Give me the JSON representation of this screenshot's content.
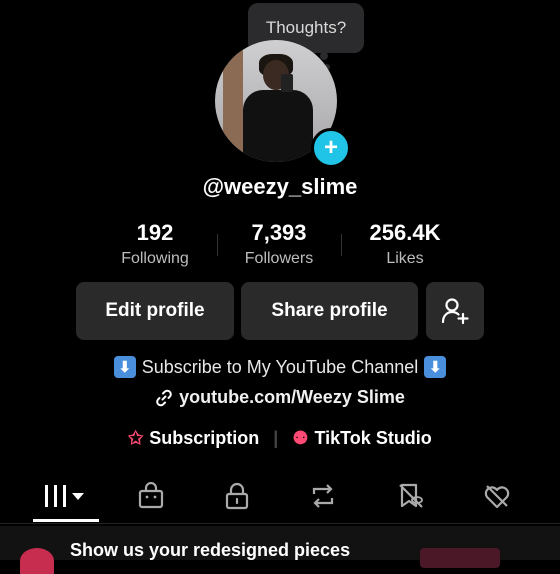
{
  "profile": {
    "tooltip": "Thoughts?",
    "username": "@weezy_slime"
  },
  "stats": [
    {
      "value": "192",
      "label": "Following"
    },
    {
      "value": "7,393",
      "label": "Followers"
    },
    {
      "value": "256.4K",
      "label": "Likes"
    }
  ],
  "buttons": {
    "edit": "Edit profile",
    "share": "Share profile",
    "add_friend_icon": "add-person-icon"
  },
  "bio": {
    "line1": "Subscribe to My YouTube Channel",
    "link": "youtube.com/Weezy Slime"
  },
  "shortcuts": {
    "subscription": "Subscription",
    "studio": "TikTok Studio"
  },
  "tabs": [
    "grid-icon",
    "shop-icon",
    "lock-icon",
    "repost-icon",
    "favorites-icon",
    "liked-icon"
  ],
  "banner": {
    "text": "Show us your redesigned pieces"
  },
  "colors": {
    "accent_cyan": "#20c4e6",
    "accent_pink": "#fe4a74",
    "button_bg": "#2a2a2a"
  }
}
